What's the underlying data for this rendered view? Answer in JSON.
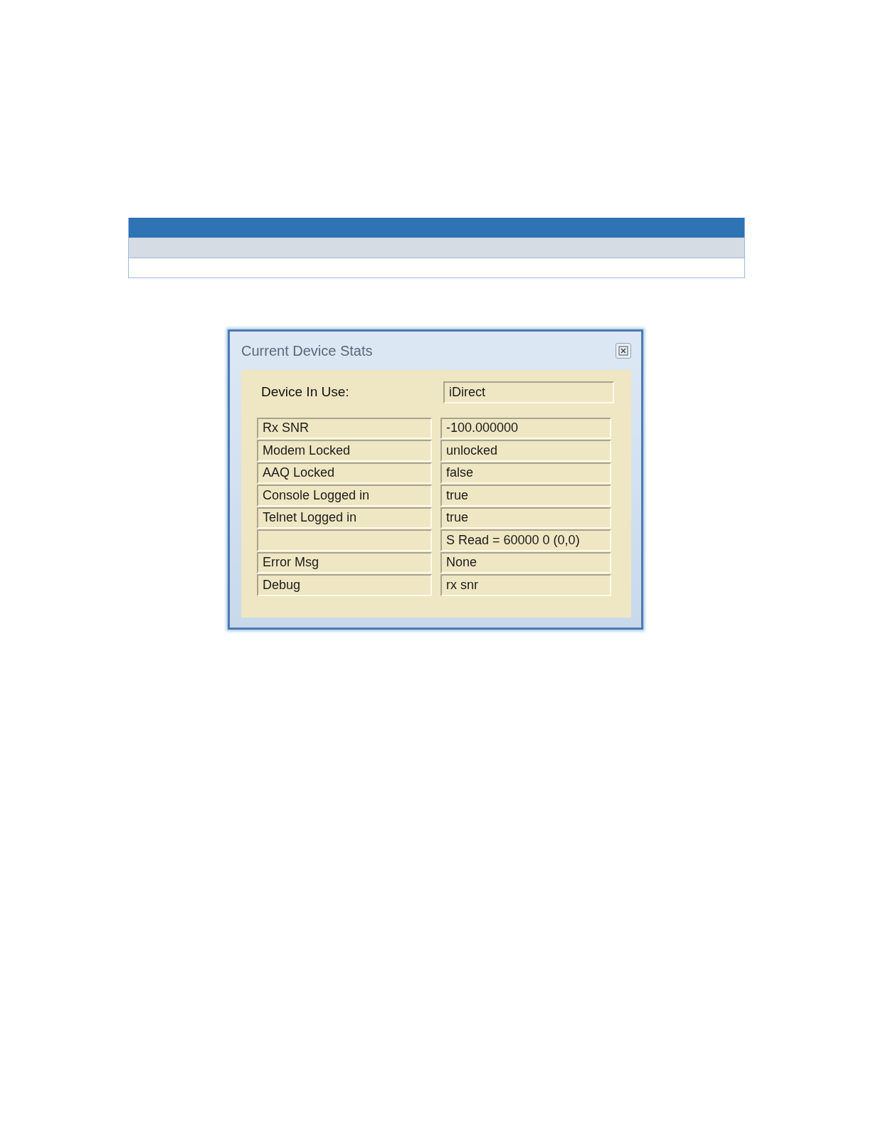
{
  "dialog": {
    "title": "Current Device Stats",
    "device_in_use": {
      "label": "Device In Use:",
      "value": "iDirect"
    },
    "stats": [
      {
        "label": "Rx SNR",
        "value": "-100.000000"
      },
      {
        "label": "Modem Locked",
        "value": "unlocked"
      },
      {
        "label": "AAQ Locked",
        "value": "false"
      },
      {
        "label": "Console Logged in",
        "value": "true"
      },
      {
        "label": "Telnet Logged in",
        "value": "true"
      },
      {
        "value": "S Read = 60000 0 (0,0)"
      },
      {
        "label": "Error Msg",
        "value": "None"
      },
      {
        "label": "Debug",
        "value": "rx snr"
      }
    ]
  }
}
